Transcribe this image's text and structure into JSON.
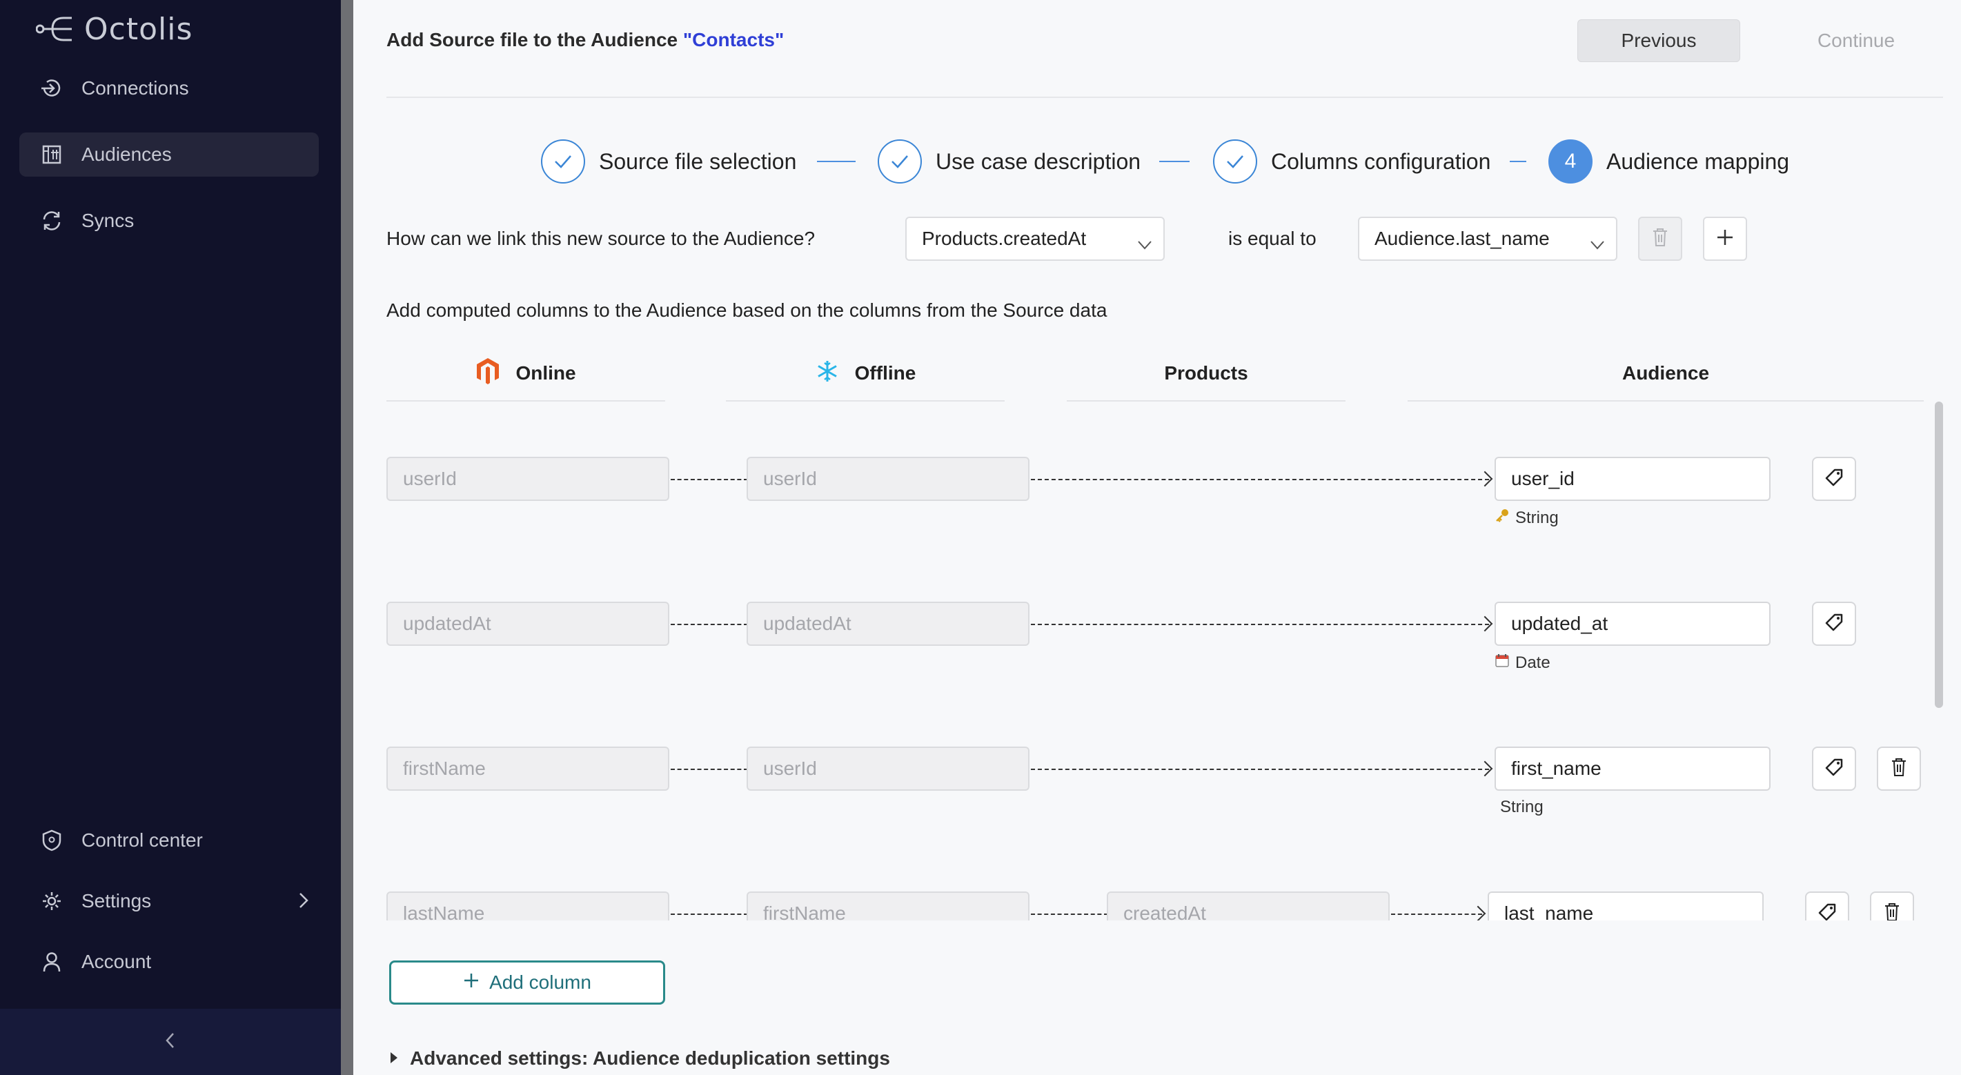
{
  "sidebar": {
    "logo": "Octolis",
    "items": [
      {
        "label": "Connections",
        "icon": "login-arrow-icon"
      },
      {
        "label": "Audiences",
        "icon": "audience-grid-icon"
      },
      {
        "label": "Syncs",
        "icon": "sync-icon"
      }
    ],
    "bottom_items": [
      {
        "label": "Control center",
        "icon": "shield-icon"
      },
      {
        "label": "Settings",
        "icon": "gear-icon"
      },
      {
        "label": "Account",
        "icon": "user-icon"
      }
    ],
    "collapse_icon": "chevron-left-icon"
  },
  "header": {
    "title_prefix": "Add Source file to the Audience ",
    "audience_name": "\"Contacts\"",
    "previous": "Previous",
    "continue": "Continue"
  },
  "stepper": {
    "steps": [
      {
        "label": "Source file selection",
        "state": "done"
      },
      {
        "label": "Use case description",
        "state": "done"
      },
      {
        "label": "Columns configuration",
        "state": "done"
      },
      {
        "label": "Audience mapping",
        "state": "current",
        "number": "4"
      }
    ]
  },
  "link": {
    "question": "How can we link this new source to the Audience?",
    "source_value": "Products.createdAt",
    "operator": "is equal to",
    "target_value": "Audience.last_name"
  },
  "computed_text": "Add computed columns to the Audience based on the columns from the Source data",
  "columns": {
    "online": "Online",
    "offline": "Offline",
    "products": "Products",
    "audience": "Audience"
  },
  "rows": [
    {
      "online": "userId",
      "offline": "userId",
      "products": "",
      "target": "user_id",
      "type": "String",
      "type_icon": "key-icon",
      "deletable": false
    },
    {
      "online": "updatedAt",
      "offline": "updatedAt",
      "products": "",
      "target": "updated_at",
      "type": "Date",
      "type_icon": "calendar-icon",
      "deletable": false
    },
    {
      "online": "firstName",
      "offline": "userId",
      "products": "",
      "target": "first_name",
      "type": "String",
      "type_icon": "",
      "deletable": true
    },
    {
      "online": "lastName",
      "offline": "firstName",
      "products": "createdAt",
      "target": "last_name",
      "type": "",
      "type_icon": "",
      "deletable": true
    }
  ],
  "add_column": "Add column",
  "advanced": "Advanced settings: Audience deduplication settings",
  "colors": {
    "sidebar_bg": "#11122a",
    "accent_blue": "#4d8fe0",
    "audience_link": "#2f3fd6",
    "teal": "#2a8a8a",
    "magento_orange": "#e85d22",
    "snowflake_blue": "#29b5e8"
  }
}
